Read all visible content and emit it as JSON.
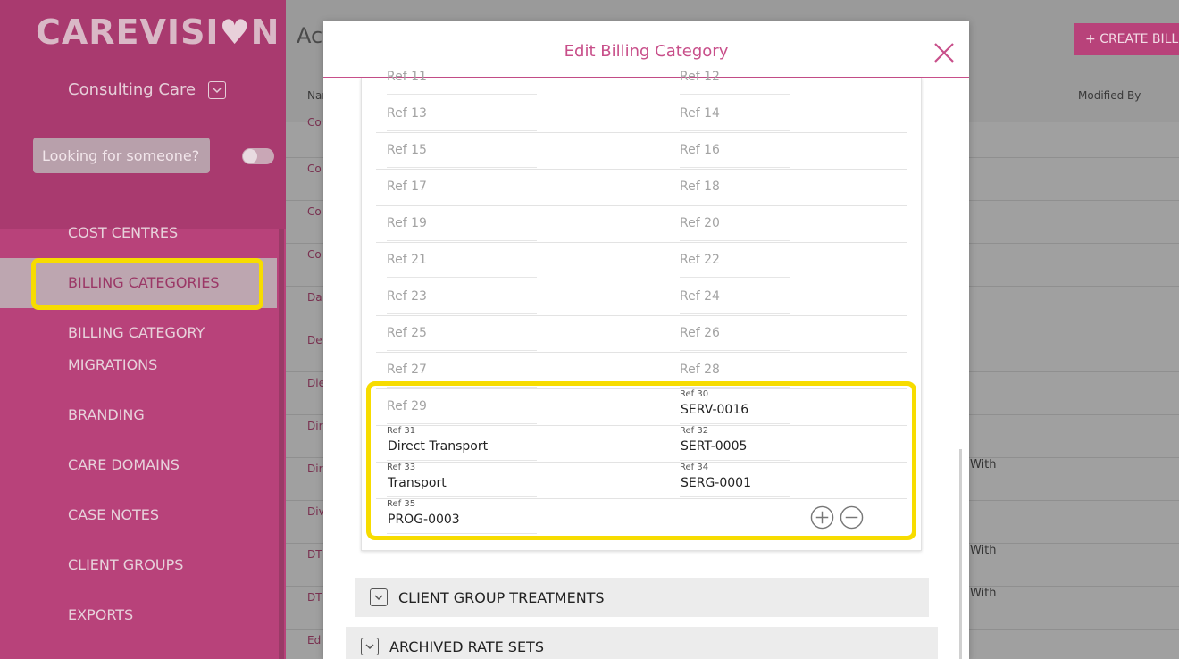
{
  "app": {
    "logo_text_1": "CAREVISI",
    "logo_heart": "♥",
    "logo_text_2": "N",
    "organisation": "Consulting Care",
    "search_placeholder": "Looking for someone?"
  },
  "sidebar": {
    "items": [
      {
        "label": "COST CENTRES"
      },
      {
        "label": "BILLING CATEGORIES",
        "active": true
      },
      {
        "label": "BILLING CATEGORY"
      },
      {
        "label": "MIGRATIONS"
      },
      {
        "label": "BRANDING"
      },
      {
        "label": "CARE DOMAINS"
      },
      {
        "label": "CASE NOTES"
      },
      {
        "label": "CLIENT GROUPS"
      },
      {
        "label": "EXPORTS"
      }
    ]
  },
  "main": {
    "title": "Act",
    "create_button": "+ CREATE BILLIN",
    "columns": {
      "name": "Nam",
      "modified_by": "Modified By"
    },
    "rows": [
      {
        "name": "Co"
      },
      {
        "name": "Co"
      },
      {
        "name": "Co"
      },
      {
        "name": "Co"
      },
      {
        "name": "Da"
      },
      {
        "name": "De"
      },
      {
        "name": "Die"
      },
      {
        "name": "Dir"
      },
      {
        "name": "Dir",
        "extra": "With"
      },
      {
        "name": "Div"
      },
      {
        "name": "DT",
        "extra": "With"
      },
      {
        "name": "DT",
        "extra": "With"
      },
      {
        "name": "Ed"
      }
    ]
  },
  "modal": {
    "title": "Edit Billing Category",
    "refs": [
      {
        "left": {
          "placeholder": "Ref 11"
        },
        "right": {
          "placeholder": "Ref 12"
        }
      },
      {
        "left": {
          "placeholder": "Ref 13"
        },
        "right": {
          "placeholder": "Ref 14"
        }
      },
      {
        "left": {
          "placeholder": "Ref 15"
        },
        "right": {
          "placeholder": "Ref 16"
        }
      },
      {
        "left": {
          "placeholder": "Ref 17"
        },
        "right": {
          "placeholder": "Ref 18"
        }
      },
      {
        "left": {
          "placeholder": "Ref 19"
        },
        "right": {
          "placeholder": "Ref 20"
        }
      },
      {
        "left": {
          "placeholder": "Ref 21"
        },
        "right": {
          "placeholder": "Ref 22"
        }
      },
      {
        "left": {
          "placeholder": "Ref 23"
        },
        "right": {
          "placeholder": "Ref 24"
        }
      },
      {
        "left": {
          "placeholder": "Ref 25"
        },
        "right": {
          "placeholder": "Ref 26"
        }
      },
      {
        "left": {
          "placeholder": "Ref 27"
        },
        "right": {
          "placeholder": "Ref 28"
        }
      },
      {
        "left": {
          "placeholder": "Ref 29"
        },
        "right": {
          "label": "Ref 30",
          "value": "SERV-0016"
        }
      },
      {
        "left": {
          "label": "Ref 31",
          "value": "Direct Transport"
        },
        "right": {
          "label": "Ref 32",
          "value": "SERT-0005"
        }
      },
      {
        "left": {
          "label": "Ref 33",
          "value": "Transport"
        },
        "right": {
          "label": "Ref 34",
          "value": "SERG-0001"
        }
      },
      {
        "left": {
          "label": "Ref 35",
          "value": "PROG-0003"
        }
      }
    ],
    "sections": [
      {
        "label": "CLIENT GROUP TREATMENTS"
      },
      {
        "label": "ARCHIVED RATE SETS"
      }
    ]
  }
}
